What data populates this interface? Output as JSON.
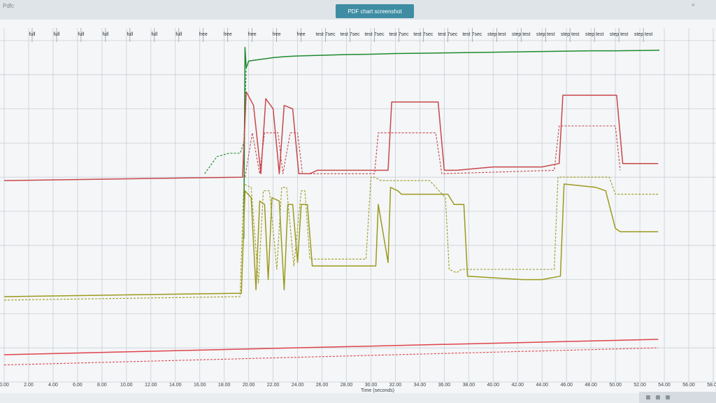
{
  "window": {
    "title": "Pdfc",
    "close": "×"
  },
  "toolbar": {
    "pdf_label": "PDF chart screenshot"
  },
  "chart_data": {
    "type": "line",
    "title": "",
    "xlabel": "Time (seconds)",
    "ylabel": "",
    "xlim": [
      0,
      58
    ],
    "ylim": [
      0,
      100
    ],
    "grid": true,
    "legend": "none",
    "x_ticks": [
      0,
      2,
      4,
      6,
      8,
      10,
      12,
      14,
      16,
      18,
      20,
      22,
      24,
      26,
      28,
      30,
      32,
      34,
      36,
      38,
      40,
      42,
      44,
      46,
      48,
      50,
      52,
      54,
      56,
      58
    ],
    "x_tick_labels": [
      "0.00",
      "2.00",
      "4.00",
      "6.00",
      "8.00",
      "10.00",
      "12.00",
      "14.00",
      "16.00",
      "18.00",
      "20.00",
      "22.00",
      "24.00",
      "26.00",
      "28.00",
      "30.00",
      "32.00",
      "34.00",
      "36.00",
      "38.00",
      "40.00",
      "42.00",
      "44.00",
      "46.00",
      "48.00",
      "50.00",
      "52.00",
      "54.00",
      "56.00",
      "58.00"
    ],
    "annotations": [
      {
        "x": 2,
        "text": "full"
      },
      {
        "x": 4,
        "text": "full"
      },
      {
        "x": 6,
        "text": "full"
      },
      {
        "x": 8,
        "text": "full"
      },
      {
        "x": 10,
        "text": "full"
      },
      {
        "x": 12,
        "text": "full"
      },
      {
        "x": 14,
        "text": "full"
      },
      {
        "x": 16,
        "text": "free"
      },
      {
        "x": 18,
        "text": "free"
      },
      {
        "x": 20,
        "text": "free"
      },
      {
        "x": 22,
        "text": "free"
      },
      {
        "x": 24,
        "text": "free"
      },
      {
        "x": 26,
        "text": "test 7sec"
      },
      {
        "x": 28,
        "text": "test 7sec"
      },
      {
        "x": 30,
        "text": "test 7sec"
      },
      {
        "x": 32,
        "text": "test 7sec"
      },
      {
        "x": 34,
        "text": "test 7sec"
      },
      {
        "x": 36,
        "text": "test 7sec"
      },
      {
        "x": 38,
        "text": "test 7sec"
      },
      {
        "x": 40,
        "text": "step test"
      },
      {
        "x": 42,
        "text": "step test"
      },
      {
        "x": 44,
        "text": "step test"
      },
      {
        "x": 46,
        "text": "step test"
      },
      {
        "x": 48,
        "text": "step test"
      },
      {
        "x": 50,
        "text": "step test"
      },
      {
        "x": 52,
        "text": "step test"
      }
    ],
    "series": [
      {
        "color": "#1f8a2e",
        "style": "solid",
        "x": [
          19.6,
          19.7,
          19.8,
          20.0,
          21,
          22,
          23,
          24,
          26,
          28,
          30,
          32,
          34,
          36,
          38,
          40,
          42,
          44,
          46,
          48,
          50,
          52,
          53.6
        ],
        "y": [
          42,
          98,
          92,
          94,
          94.5,
          95,
          95.3,
          95.5,
          95.7,
          95.9,
          96.0,
          96.2,
          96.3,
          96.4,
          96.5,
          96.6,
          96.7,
          96.8,
          96.9,
          97.0,
          97.0,
          97.1,
          97.2
        ]
      },
      {
        "color": "#1f8a2e",
        "style": "dashed",
        "x": [
          16.4,
          17.0,
          17.4,
          18.4,
          19.3,
          19.6,
          19.8
        ],
        "y": [
          61,
          64,
          66,
          67,
          67,
          70,
          92
        ]
      },
      {
        "color": "#c8474a",
        "style": "solid",
        "x": [
          0,
          19.5,
          19.8,
          20.4,
          21.0,
          21.4,
          22.0,
          22.5,
          22.9,
          23.6,
          24.1,
          24.5,
          25.0,
          25.6,
          27,
          30,
          31.4,
          31.7,
          35.5,
          36.0,
          37,
          40,
          42,
          44,
          45.4,
          45.7,
          50.1,
          50.6,
          53.5
        ],
        "y": [
          59,
          60,
          85,
          81,
          61,
          83,
          80,
          61,
          81,
          80,
          61,
          61,
          61,
          62,
          62,
          62,
          62,
          82,
          82,
          62,
          62,
          63,
          63,
          63,
          64,
          84,
          84,
          64,
          64
        ]
      },
      {
        "color": "#c8474a",
        "style": "dashed",
        "x": [
          19.7,
          20.3,
          20.9,
          21.3,
          22.4,
          22.8,
          23.4,
          24.0,
          24.4,
          30.3,
          30.6,
          35.3,
          35.8,
          45.0,
          45.4,
          50.0,
          50.4
        ],
        "y": [
          60,
          73,
          61,
          73,
          73,
          61,
          73,
          73,
          61,
          61,
          73,
          73,
          61,
          62,
          75,
          75,
          62
        ]
      },
      {
        "color": "#9c9a1c",
        "style": "solid",
        "x": [
          0,
          19.4,
          19.7,
          20.2,
          20.6,
          20.9,
          21.3,
          21.6,
          21.9,
          22.5,
          22.9,
          23.2,
          23.6,
          24.0,
          24.3,
          24.8,
          25.2,
          29.4,
          30.4,
          30.6,
          31.4,
          31.6,
          32.2,
          32.5,
          36.3,
          36.8,
          37.6,
          37.9,
          42.4,
          44.0,
          45.5,
          45.8,
          48.4,
          49.2,
          50.0,
          50.4,
          53.5
        ],
        "y": [
          25,
          26,
          56,
          54,
          27,
          53,
          52,
          30,
          54,
          53,
          27,
          52,
          52,
          35,
          52,
          52,
          34,
          34,
          34,
          52,
          35,
          57,
          56,
          55,
          55,
          52,
          52,
          31,
          30,
          30,
          31,
          58,
          57,
          56,
          45,
          44,
          44
        ]
      },
      {
        "color": "#9c9a1c",
        "style": "dashed",
        "x": [
          0,
          19.3,
          19.6,
          20.2,
          20.8,
          21.2,
          21.7,
          22.3,
          22.7,
          23.1,
          23.7,
          24.3,
          24.6,
          25.0,
          29.6,
          30.0,
          30.3,
          30.8,
          34.8,
          36.1,
          36.4,
          37.0,
          37.4,
          42.4,
          44.0,
          45.0,
          45.3,
          49.5,
          50.0,
          53.5
        ],
        "y": [
          24,
          25,
          58,
          57,
          29,
          56,
          56,
          33,
          57,
          57,
          34,
          56,
          56,
          36,
          36,
          60,
          60,
          59,
          59,
          54,
          33,
          32,
          33,
          33,
          33,
          33,
          60,
          60,
          55,
          55
        ]
      },
      {
        "color": "#e0434a",
        "style": "solid",
        "x": [
          0,
          53.5
        ],
        "y": [
          8,
          12.5
        ]
      },
      {
        "color": "#e0434a",
        "style": "dashed",
        "x": [
          0,
          53.5
        ],
        "y": [
          5,
          10
        ]
      }
    ]
  }
}
